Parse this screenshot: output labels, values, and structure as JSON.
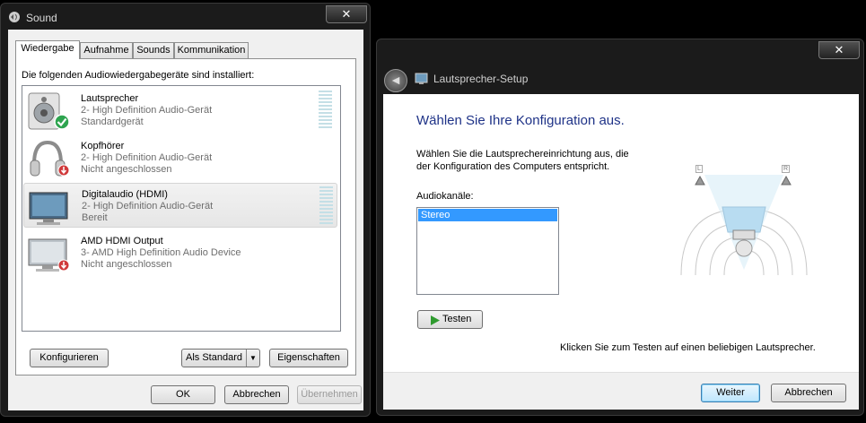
{
  "sound": {
    "title": "Sound",
    "tabs": [
      "Wiedergabe",
      "Aufnahme",
      "Sounds",
      "Kommunikation"
    ],
    "instruction": "Die folgenden Audiowiedergabegeräte sind installiert:",
    "devices": [
      {
        "name": "Lautsprecher",
        "line2": "2- High Definition Audio-Gerät",
        "line3": "Standardgerät",
        "icon": "speaker-icon",
        "status": "default-check",
        "selected": false
      },
      {
        "name": "Kopfhörer",
        "line2": "2- High Definition Audio-Gerät",
        "line3": "Nicht angeschlossen",
        "icon": "headphones-icon",
        "status": "unplugged",
        "selected": false
      },
      {
        "name": "Digitalaudio (HDMI)",
        "line2": "2- High Definition Audio-Gerät",
        "line3": "Bereit",
        "icon": "monitor-icon",
        "status": "ready",
        "selected": true
      },
      {
        "name": "AMD HDMI Output",
        "line2": "3- AMD High Definition Audio Device",
        "line3": "Nicht angeschlossen",
        "icon": "monitor-icon",
        "status": "unplugged",
        "selected": false
      }
    ],
    "buttons": {
      "configure": "Konfigurieren",
      "set_default": "Als Standard",
      "properties": "Eigenschaften",
      "ok": "OK",
      "cancel": "Abbrechen",
      "apply": "Übernehmen"
    },
    "close": "✕"
  },
  "setup": {
    "title": "Lautsprecher-Setup",
    "heading": "Wählen Sie Ihre Konfiguration aus.",
    "description_1": "Wählen Sie die Lautsprechereinrichtung aus, die",
    "description_2": "der Konfiguration des Computers entspricht.",
    "channels_label": "Audiokanäle:",
    "channels": [
      "Stereo"
    ],
    "selected_channel": "Stereo",
    "test_button": "Testen",
    "hint": "Klicken Sie zum Testen auf einen beliebigen Lautsprecher.",
    "speaker_left": "L",
    "speaker_right": "R",
    "buttons": {
      "next": "Weiter",
      "cancel": "Abbrechen"
    },
    "close": "✕"
  },
  "colors": {
    "accent": "#1e3287",
    "selection": "#3399ff",
    "check": "#2ea44f",
    "unplug": "#d0393a"
  }
}
